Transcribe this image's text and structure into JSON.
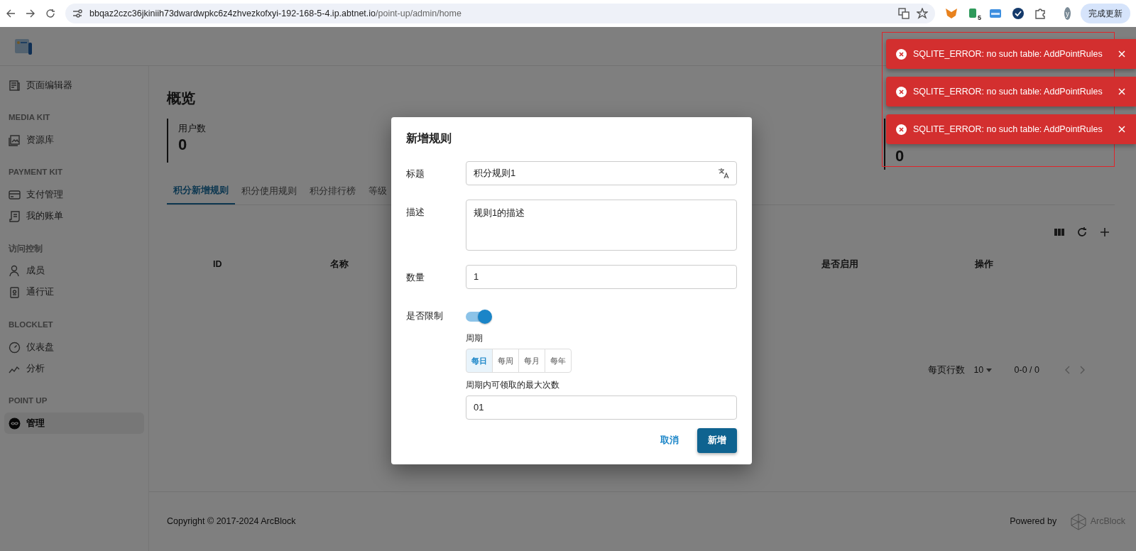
{
  "browser": {
    "url_host": "bbqaz2czc36jkiniih73dwardwpkc6z4zhvezkofxyi-192-168-5-4.ip.abtnet.io",
    "url_path": "/point-up/admin/home",
    "extension_badge": "5",
    "avatar": "y",
    "update_button": "完成更新"
  },
  "sidebar": {
    "items": [
      {
        "kind": "link",
        "label": "页面编辑器",
        "selected": false
      },
      {
        "kind": "heading",
        "label": "MEDIA KIT"
      },
      {
        "kind": "link",
        "label": "资源库",
        "selected": false
      },
      {
        "kind": "heading",
        "label": "PAYMENT KIT"
      },
      {
        "kind": "link",
        "label": "支付管理",
        "selected": false
      },
      {
        "kind": "link",
        "label": "我的账单",
        "selected": false
      },
      {
        "kind": "heading",
        "label": "访问控制"
      },
      {
        "kind": "link",
        "label": "成员",
        "selected": false
      },
      {
        "kind": "link",
        "label": "通行证",
        "selected": false
      },
      {
        "kind": "heading",
        "label": "BLOCKLET"
      },
      {
        "kind": "link",
        "label": "仪表盘",
        "selected": false
      },
      {
        "kind": "link",
        "label": "分析",
        "selected": false
      },
      {
        "kind": "heading",
        "label": "POINT UP"
      },
      {
        "kind": "link",
        "label": "管理",
        "selected": true
      }
    ]
  },
  "page_title": "概览",
  "stats": [
    {
      "label": "用户数",
      "value": "0"
    },
    {
      "value": "0"
    }
  ],
  "tabs": [
    {
      "label": "积分新增规则",
      "selected": true
    },
    {
      "label": "积分使用规则",
      "selected": false
    },
    {
      "label": "积分排行榜",
      "selected": false
    },
    {
      "label": "等级",
      "selected": false
    }
  ],
  "table": {
    "columns": [
      "ID",
      "名称",
      "是否启用",
      "操作"
    ],
    "pagination": {
      "rows_label": "每页行数",
      "rows_value": "10",
      "range": "0-0 / 0"
    }
  },
  "footer": {
    "copyright": "Copyright © 2017-2024  ArcBlock",
    "powered_by": "Powered by",
    "brand": "ArcBlock"
  },
  "toasts": [
    {
      "message": "SQLITE_ERROR: no such table: AddPointRules"
    },
    {
      "message": "SQLITE_ERROR: no such table: AddPointRules"
    },
    {
      "message": "SQLITE_ERROR: no such table: AddPointRules"
    }
  ],
  "modal": {
    "title": "新增规则",
    "fields": [
      {
        "kind": "text",
        "label": "标题",
        "value": "积分规则1",
        "translatable": true
      },
      {
        "kind": "textarea",
        "label": "描述",
        "value": "规则1的描述"
      },
      {
        "kind": "text",
        "label": "数量",
        "value": "1",
        "translatable": false
      },
      {
        "kind": "switch",
        "label": "是否限制",
        "on": true
      }
    ],
    "period": {
      "label": "周期",
      "options": [
        {
          "label": "每日",
          "selected": true
        },
        {
          "label": "每周",
          "selected": false
        },
        {
          "label": "每月",
          "selected": false
        },
        {
          "label": "每年",
          "selected": false
        }
      ]
    },
    "max_claims": {
      "label": "周期内可领取的最大次数",
      "value": "01"
    },
    "cancel": "取消",
    "submit": "新增"
  }
}
